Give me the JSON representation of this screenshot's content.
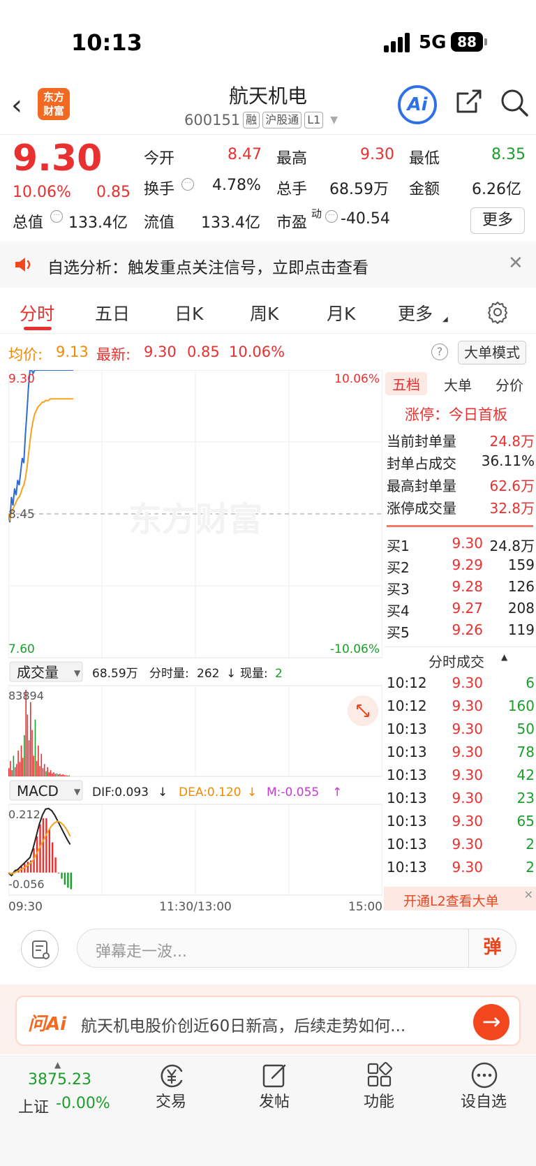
{
  "status": {
    "time": "10:13",
    "network": "5G",
    "battery": "88"
  },
  "header": {
    "title": "航天机电",
    "code": "600151",
    "tags": [
      "融",
      "沪股通",
      "L1"
    ],
    "logo_text_1": "东方",
    "logo_text_2": "财富",
    "ai_label": "Ai"
  },
  "quote": {
    "price": "9.30",
    "change_pct": "10.06%",
    "change": "0.85",
    "open_label": "今开",
    "open": "8.47",
    "high_label": "最高",
    "high": "9.30",
    "low_label": "最低",
    "low": "8.35",
    "turnover_label": "换手",
    "turnover": "4.78%",
    "volume_label": "总手",
    "volume": "68.59万",
    "amount_label": "金额",
    "amount": "6.26亿",
    "mktcap_label": "总值",
    "mktcap": "133.4亿",
    "float_label": "流值",
    "float": "133.4亿",
    "pe_label": "市盈",
    "pe_sup": "动",
    "pe": "-40.54",
    "more": "更多"
  },
  "notice": {
    "text": "自选分析：触发重点关注信号，立即点击查看"
  },
  "tabs": [
    "分时",
    "五日",
    "日K",
    "周K",
    "月K",
    "更多"
  ],
  "avg": {
    "avg_label": "均价:",
    "avg_value": "9.13",
    "latest_label": "最新:",
    "latest_value": "9.30",
    "change": "0.85",
    "pct": "10.06%",
    "big_mode": "大单模式"
  },
  "chart_data": [
    {
      "type": "line",
      "title": "",
      "y_labels": {
        "top": "9.30",
        "mid": "8.45",
        "bottom": "7.60",
        "top_pct": "10.06%",
        "bottom_pct": "-10.06%"
      },
      "ylim": [
        7.6,
        9.3
      ],
      "x_labels": [
        "09:30",
        "11:30/13:00",
        "15:00"
      ],
      "watermark": "东方财富",
      "series": [
        {
          "name": "最新",
          "color": "#2f6bd1",
          "values": [
            8.45,
            8.4,
            8.55,
            8.5,
            8.6,
            8.56,
            8.65,
            8.62,
            8.7,
            8.78,
            8.75,
            8.92,
            9.05,
            9.2,
            9.3,
            9.3,
            9.28,
            9.3,
            9.3,
            9.3,
            9.3,
            9.3,
            9.3,
            9.3,
            9.3,
            9.3,
            9.3,
            9.3,
            9.3,
            9.3,
            9.3,
            9.3,
            9.3,
            9.3,
            9.3,
            9.3,
            9.3,
            9.3,
            9.3,
            9.3,
            9.3,
            9.3,
            9.3
          ]
        },
        {
          "name": "均价",
          "color": "#f5a21f",
          "values": [
            8.45,
            8.42,
            8.46,
            8.48,
            8.5,
            8.52,
            8.54,
            8.55,
            8.57,
            8.6,
            8.62,
            8.66,
            8.72,
            8.8,
            8.88,
            8.95,
            9.0,
            9.04,
            9.06,
            9.08,
            9.09,
            9.1,
            9.11,
            9.11,
            9.12,
            9.12,
            9.12,
            9.13,
            9.13,
            9.13,
            9.13,
            9.13,
            9.13,
            9.13,
            9.13,
            9.13,
            9.13,
            9.13,
            9.13,
            9.13,
            9.13,
            9.13,
            9.13
          ]
        }
      ]
    },
    {
      "type": "bar",
      "title": "成交量",
      "info": {
        "total": "68.59万",
        "minute_label": "分时量:",
        "minute_value": "262",
        "now_label": "现量:",
        "now_value": "2"
      },
      "y_top_label": "83894",
      "ylim": [
        0,
        83894
      ],
      "values": [
        8000,
        15000,
        6000,
        20000,
        9000,
        12000,
        25000,
        14000,
        30000,
        18000,
        40000,
        83894,
        60000,
        35000,
        72000,
        45000,
        20000,
        55000,
        15000,
        30000,
        10000,
        22000,
        8000,
        12000,
        5000,
        9000,
        4000,
        6000,
        3000,
        4000,
        2500,
        3000,
        2000,
        2500,
        1500,
        2000,
        1200,
        1000,
        900,
        800
      ]
    },
    {
      "type": "line",
      "title": "MACD",
      "info": {
        "dif": "DIF:0.093",
        "dea": "DEA:0.120",
        "m": "M:-0.055"
      },
      "y_labels": {
        "top": "0.212",
        "bottom": "-0.056"
      },
      "ylim": [
        -0.056,
        0.212
      ],
      "series": [
        {
          "name": "DIF",
          "color": "#222222",
          "values": [
            0.0,
            -0.01,
            0.005,
            0.01,
            0.02,
            0.03,
            0.04,
            0.05,
            0.08,
            0.12,
            0.16,
            0.19,
            0.21,
            0.212,
            0.205,
            0.19,
            0.17,
            0.15,
            0.13,
            0.11,
            0.093
          ]
        },
        {
          "name": "DEA",
          "color": "#f5a21f",
          "values": [
            0.0,
            -0.005,
            0.0,
            0.005,
            0.01,
            0.015,
            0.022,
            0.03,
            0.04,
            0.06,
            0.08,
            0.1,
            0.12,
            0.14,
            0.155,
            0.165,
            0.17,
            0.165,
            0.155,
            0.14,
            0.12
          ]
        },
        {
          "name": "M",
          "color": "#e93030",
          "values": [
            0.0,
            -0.01,
            0.01,
            0.01,
            0.02,
            0.03,
            0.036,
            0.04,
            0.08,
            0.12,
            0.16,
            0.18,
            0.18,
            0.144,
            0.1,
            0.05,
            0.0,
            -0.02,
            -0.04,
            -0.05,
            -0.055
          ]
        }
      ]
    }
  ],
  "right_panel": {
    "tabs": [
      "五档",
      "大单",
      "分价"
    ],
    "limit_up": "涨停：今日首板",
    "stats": [
      {
        "label": "当前封单量",
        "value": "24.8万"
      },
      {
        "label": "封单占成交",
        "value": "36.11%"
      },
      {
        "label": "最高封单量",
        "value": "62.6万"
      },
      {
        "label": "涨停成交量",
        "value": "32.8万"
      }
    ],
    "bids": [
      {
        "label": "买1",
        "price": "9.30",
        "vol": "24.8万"
      },
      {
        "label": "买2",
        "price": "9.29",
        "vol": "159"
      },
      {
        "label": "买3",
        "price": "9.28",
        "vol": "126"
      },
      {
        "label": "买4",
        "price": "9.27",
        "vol": "208"
      },
      {
        "label": "买5",
        "price": "9.26",
        "vol": "119"
      }
    ],
    "trades_title": "分时成交",
    "trades": [
      {
        "time": "10:12",
        "price": "9.30",
        "vol": "6"
      },
      {
        "time": "10:12",
        "price": "9.30",
        "vol": "160"
      },
      {
        "time": "10:13",
        "price": "9.30",
        "vol": "50"
      },
      {
        "time": "10:13",
        "price": "9.30",
        "vol": "78"
      },
      {
        "time": "10:13",
        "price": "9.30",
        "vol": "42"
      },
      {
        "time": "10:13",
        "price": "9.30",
        "vol": "23"
      },
      {
        "time": "10:13",
        "price": "9.30",
        "vol": "65"
      },
      {
        "time": "10:13",
        "price": "9.30",
        "vol": "2"
      },
      {
        "time": "10:13",
        "price": "9.30",
        "vol": "2"
      }
    ],
    "l2_banner": "开通L2查看大单"
  },
  "danmu": {
    "placeholder": "弹幕走一波...",
    "send": "弹"
  },
  "ask": {
    "logo": "问Ai",
    "text": "航天机电股价创近60日新高，后续走势如何..."
  },
  "tabbar": {
    "index_value": "3875.23",
    "index_name": "上证",
    "index_change": "-0.00%",
    "items": [
      "交易",
      "发帖",
      "功能",
      "设自选"
    ]
  }
}
